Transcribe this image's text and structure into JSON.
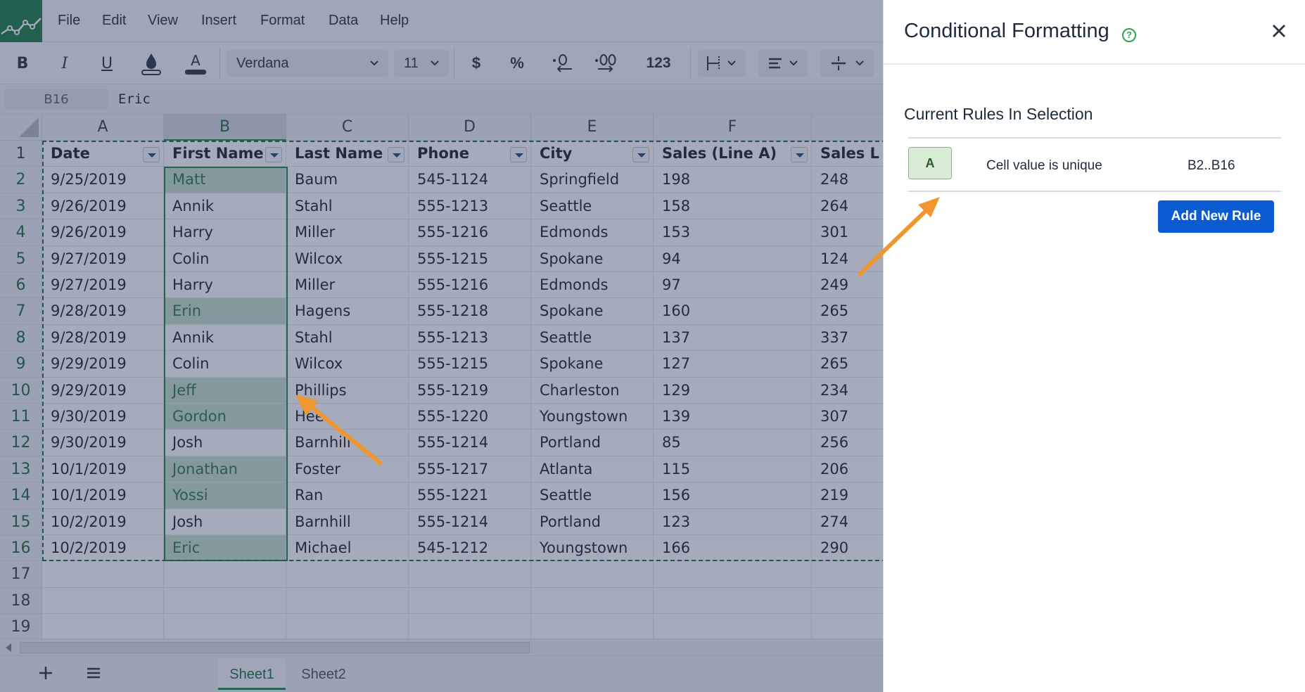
{
  "app": {
    "menu": [
      "File",
      "Edit",
      "View",
      "Insert",
      "Format",
      "Data",
      "Help"
    ]
  },
  "toolbar": {
    "bold": "B",
    "italic": "I",
    "underline": "U",
    "font_color_glyph": "A",
    "font_name": "Verdana",
    "font_size": "11",
    "currency": "$",
    "percent": "%",
    "number_format": "123"
  },
  "formula_bar": {
    "cell_ref": "B16",
    "value": "Eric"
  },
  "columns": [
    "A",
    "B",
    "C",
    "D",
    "E",
    "F",
    ""
  ],
  "selected_column": "B",
  "rows": [
    {
      "num": "1",
      "cells": [
        "Date",
        "First Name",
        "Last Name",
        "Phone",
        "City",
        "Sales (Line A)",
        "Sales L"
      ]
    },
    {
      "num": "2",
      "cells": [
        "9/25/2019",
        "Matt",
        "Baum",
        "545-1124",
        "Springfield",
        "198",
        "248"
      ]
    },
    {
      "num": "3",
      "cells": [
        "9/26/2019",
        "Annik",
        "Stahl",
        "555-1213",
        "Seattle",
        "158",
        "264"
      ]
    },
    {
      "num": "4",
      "cells": [
        "9/26/2019",
        "Harry",
        "Miller",
        "555-1216",
        "Edmonds",
        "153",
        "301"
      ]
    },
    {
      "num": "5",
      "cells": [
        "9/27/2019",
        "Colin",
        "Wilcox",
        "555-1215",
        "Spokane",
        "94",
        "124"
      ]
    },
    {
      "num": "6",
      "cells": [
        "9/27/2019",
        "Harry",
        "Miller",
        "555-1216",
        "Edmonds",
        "97",
        "249"
      ]
    },
    {
      "num": "7",
      "cells": [
        "9/28/2019",
        "Erin",
        "Hagens",
        "555-1218",
        "Spokane",
        "160",
        "265"
      ]
    },
    {
      "num": "8",
      "cells": [
        "9/28/2019",
        "Annik",
        "Stahl",
        "555-1213",
        "Seattle",
        "137",
        "337"
      ]
    },
    {
      "num": "9",
      "cells": [
        "9/29/2019",
        "Colin",
        "Wilcox",
        "555-1215",
        "Spokane",
        "127",
        "265"
      ]
    },
    {
      "num": "10",
      "cells": [
        "9/29/2019",
        "Jeff",
        "Phillips",
        "555-1219",
        "Charleston",
        "129",
        "234"
      ]
    },
    {
      "num": "11",
      "cells": [
        "9/30/2019",
        "Gordon",
        "Hee",
        "555-1220",
        "Youngstown",
        "139",
        "307"
      ]
    },
    {
      "num": "12",
      "cells": [
        "9/30/2019",
        "Josh",
        "Barnhill",
        "555-1214",
        "Portland",
        "85",
        "256"
      ]
    },
    {
      "num": "13",
      "cells": [
        "10/1/2019",
        "Jonathan",
        "Foster",
        "555-1217",
        "Atlanta",
        "115",
        "206"
      ]
    },
    {
      "num": "14",
      "cells": [
        "10/1/2019",
        "Yossi",
        "Ran",
        "555-1221",
        "Seattle",
        "156",
        "219"
      ]
    },
    {
      "num": "15",
      "cells": [
        "10/2/2019",
        "Josh",
        "Barnhill",
        "555-1214",
        "Portland",
        "123",
        "274"
      ]
    },
    {
      "num": "16",
      "cells": [
        "10/2/2019",
        "Eric",
        "Michael",
        "545-1212",
        "Youngstown",
        "166",
        "290"
      ]
    },
    {
      "num": "17",
      "cells": [
        "",
        "",
        "",
        "",
        "",
        "",
        ""
      ]
    },
    {
      "num": "18",
      "cells": [
        "",
        "",
        "",
        "",
        "",
        "",
        ""
      ]
    },
    {
      "num": "19",
      "cells": [
        "",
        "",
        "",
        "",
        "",
        "",
        ""
      ]
    }
  ],
  "highlighted_rows": [
    "2",
    "7",
    "10",
    "11",
    "13",
    "14",
    "16"
  ],
  "sheet_tabs": [
    "Sheet1",
    "Sheet2"
  ],
  "active_sheet": "Sheet1",
  "panel": {
    "title": "Conditional Formatting",
    "help_glyph": "?",
    "rules_heading": "Current Rules In Selection",
    "rules": [
      {
        "swatch_label": "A",
        "description": "Cell value is unique",
        "range": "B2..B16"
      }
    ],
    "add_rule_label": "Add New Rule"
  },
  "colors": {
    "accent_green": "#1f8a47",
    "highlight_fill": "#c8dfcd",
    "primary_button": "#0b5bd3",
    "annotation_arrow": "#f0962e",
    "overlay": "rgba(40,56,92,0.42)"
  },
  "icons": {
    "logo": "chart-logo-icon",
    "fill_color": "paint-bucket-icon",
    "decrease_decimal": "decrease-decimal-icon",
    "increase_decimal": "increase-decimal-icon",
    "borders": "borders-icon",
    "align": "align-left-icon",
    "valign": "vertical-align-icon",
    "add_sheet": "plus-icon",
    "sheet_menu": "hamburger-icon",
    "close": "close-icon",
    "help": "help-circle-icon"
  }
}
